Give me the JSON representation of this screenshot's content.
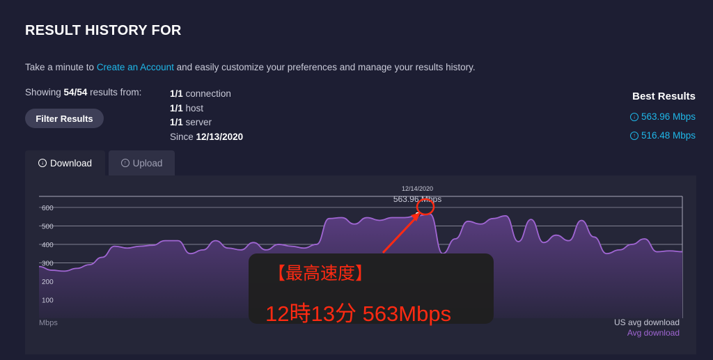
{
  "header": {
    "title": "RESULT HISTORY FOR"
  },
  "intro": {
    "prefix": "Take a minute to ",
    "link": "Create an Account",
    "suffix": " and easily customize your preferences and manage your results history."
  },
  "summary": {
    "showing_prefix": "Showing ",
    "count": "54/54",
    "showing_suffix": " results from:",
    "filter_label": "Filter Results",
    "stats": [
      {
        "value": "1/1",
        "label": " connection"
      },
      {
        "value": "1/1",
        "label": " host"
      },
      {
        "value": "1/1",
        "label": " server"
      },
      {
        "value": "Since",
        "label": " 12/13/2020"
      }
    ]
  },
  "best": {
    "title": "Best Results",
    "download": "563.96 Mbps",
    "upload": "516.48 Mbps"
  },
  "tabs": [
    {
      "label": "Download",
      "icon": "download-icon",
      "active": true
    },
    {
      "label": "Upload",
      "icon": "upload-icon",
      "active": false
    }
  ],
  "chart_data": {
    "type": "area",
    "y_ticks": [
      "600",
      "500",
      "400",
      "300",
      "200",
      "100"
    ],
    "ylim": [
      0,
      660
    ],
    "ylabel": "Mbps",
    "peak": {
      "date": "12/14/2020",
      "value_label": "563.96 Mbps",
      "value": 564,
      "index": 30
    },
    "legend": [
      "US avg download",
      "Avg download"
    ],
    "colors": {
      "series": "#a066d3",
      "us_avg": "#9e9e9e",
      "grid": "#aaaabb"
    },
    "series": [
      {
        "name": "Avg download",
        "values": [
          280,
          260,
          255,
          270,
          290,
          330,
          390,
          380,
          390,
          395,
          420,
          420,
          350,
          370,
          420,
          380,
          370,
          410,
          370,
          400,
          390,
          380,
          400,
          540,
          545,
          510,
          545,
          530,
          545,
          545,
          555,
          564,
          350,
          430,
          525,
          510,
          540,
          555,
          415,
          535,
          410,
          450,
          420,
          530,
          440,
          350,
          370,
          400,
          430,
          360,
          365,
          360
        ]
      }
    ]
  },
  "annotation": {
    "line1": "【最高速度】",
    "line2": "12時13分 563Mbps",
    "color": "#ff2a12"
  }
}
